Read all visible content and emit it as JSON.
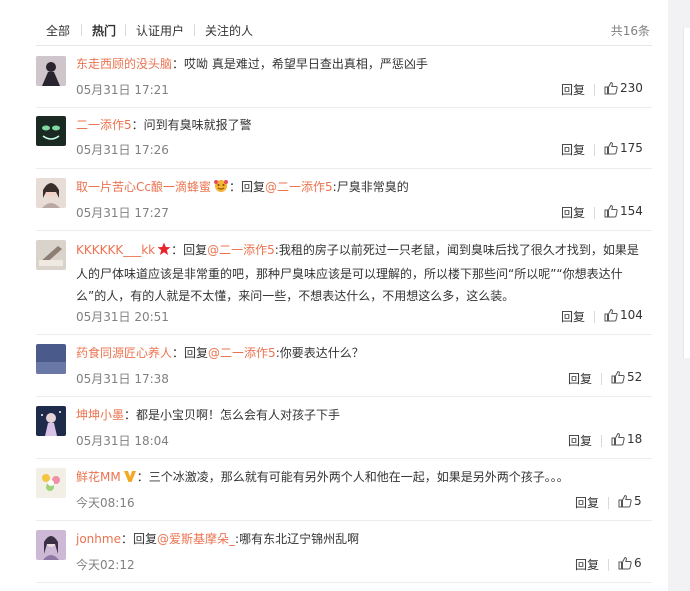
{
  "tabs": {
    "items": [
      "全部",
      "热门",
      "认证用户",
      "关注的人"
    ],
    "active_index": 1,
    "total": "共16条"
  },
  "comments": [
    {
      "user": "东走西顾的没头脑",
      "separator": "：",
      "reply_prefix": "",
      "reply_to": "",
      "reply_sep": "",
      "content": "哎呦 真是难过，希望早日查出真相，严惩凶手",
      "date": "05月31日 17:21",
      "reply_label": "回复",
      "likes": "230"
    },
    {
      "user": "二一添作5",
      "separator": "：",
      "reply_prefix": "",
      "reply_to": "",
      "reply_sep": "",
      "content": "问到有臭味就报了警",
      "date": "05月31日 17:26",
      "reply_label": "回复",
      "likes": "175"
    },
    {
      "user": "取一片苦心Cc酿一滴蜂蜜",
      "separator": "：",
      "reply_prefix": "回复",
      "reply_to": "@二一添作5",
      "reply_sep": ":",
      "content": "尸臭非常臭的",
      "date": "05月31日 17:27",
      "reply_label": "回复",
      "likes": "154"
    },
    {
      "user": "KKKKKK___kk",
      "separator": "：",
      "reply_prefix": "回复",
      "reply_to": "@二一添作5",
      "reply_sep": ":",
      "content": "我租的房子以前死过一只老鼠，闻到臭味后找了很久才找到，如果是人的尸体味道应该是非常重的吧，那种尸臭味应该是可以理解的，所以楼下那些问“所以呢”“你想表达什么”的人，有的人就是不太懂，来问一些，不想表达什么，不用想这么多，这么装。",
      "date": "05月31日 20:51",
      "reply_label": "回复",
      "likes": "104"
    },
    {
      "user": "药食同源匠心养人",
      "separator": "：",
      "reply_prefix": "回复",
      "reply_to": "@二一添作5",
      "reply_sep": ":",
      "content": "你要表达什么？",
      "date": "05月31日 17:38",
      "reply_label": "回复",
      "likes": "52"
    },
    {
      "user": "坤坤小墨",
      "separator": "：",
      "reply_prefix": "",
      "reply_to": "",
      "reply_sep": "",
      "content": "都是小宝贝啊！怎么会有人对孩子下手",
      "date": "05月31日 18:04",
      "reply_label": "回复",
      "likes": "18"
    },
    {
      "user": "鲜花MM",
      "separator": "：",
      "reply_prefix": "",
      "reply_to": "",
      "reply_sep": "",
      "content": "三个冰激凌，那么就有可能有另外两个人和他在一起，如果是另外两个孩子。。。",
      "date": "今天08:16",
      "reply_label": "回复",
      "likes": "5"
    },
    {
      "user": "jonhme",
      "separator": "：",
      "reply_prefix": "回复",
      "reply_to": "@爱斯基摩朵_",
      "reply_sep": ":",
      "content": "哪有东北辽宁锦州乱啊",
      "date": "今天02:12",
      "reply_label": "回复",
      "likes": "6"
    }
  ],
  "colors": {
    "username": "#eb7350",
    "text": "#333333",
    "meta": "#808080",
    "divider": "#ececec"
  }
}
